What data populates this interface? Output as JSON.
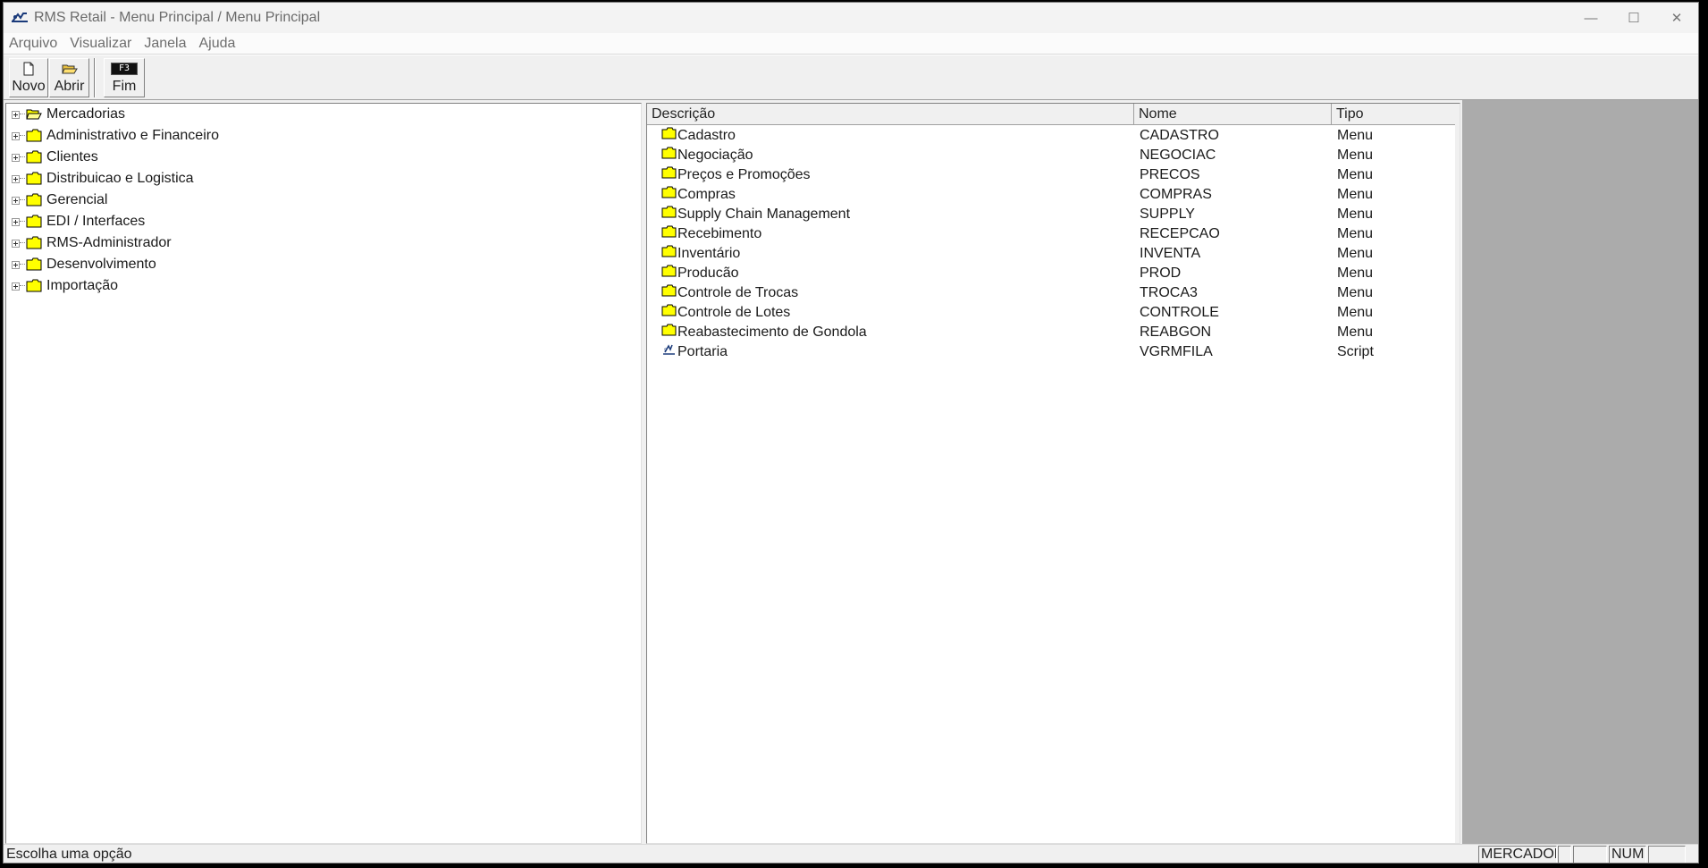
{
  "window": {
    "title": "RMS Retail - Menu Principal / Menu Principal",
    "minimize_glyph": "—",
    "maximize_glyph": "☐",
    "close_glyph": "✕"
  },
  "menubar": {
    "items": [
      "Arquivo",
      "Visualizar",
      "Janela",
      "Ajuda"
    ]
  },
  "toolbar": {
    "novo_label": "Novo",
    "novo_icon": "new-document-icon",
    "abrir_label": "Abrir",
    "abrir_icon": "open-folder-icon",
    "fim_label": "Fim",
    "fim_key": "F3"
  },
  "tree": {
    "items": [
      {
        "label": "Mercadorias",
        "icon": "open-folder-icon"
      },
      {
        "label": "Administrativo e Financeiro",
        "icon": "folder-icon"
      },
      {
        "label": "Clientes",
        "icon": "folder-icon"
      },
      {
        "label": "Distribuicao e Logistica",
        "icon": "folder-icon"
      },
      {
        "label": "Gerencial",
        "icon": "folder-icon"
      },
      {
        "label": "EDI / Interfaces",
        "icon": "folder-icon"
      },
      {
        "label": "RMS-Administrador",
        "icon": "folder-icon"
      },
      {
        "label": "Desenvolvimento",
        "icon": "folder-icon"
      },
      {
        "label": "Importação",
        "icon": "folder-icon"
      }
    ]
  },
  "list": {
    "columns": [
      "Descrição",
      "Nome",
      "Tipo"
    ],
    "rows": [
      {
        "descricao": "Cadastro",
        "nome": "CADASTRO",
        "tipo": "Menu",
        "icon": "folder-icon"
      },
      {
        "descricao": "Negociação",
        "nome": "NEGOCIAC",
        "tipo": "Menu",
        "icon": "folder-icon"
      },
      {
        "descricao": "Preços e Promoções",
        "nome": "PRECOS",
        "tipo": "Menu",
        "icon": "folder-icon"
      },
      {
        "descricao": "Compras",
        "nome": "COMPRAS",
        "tipo": "Menu",
        "icon": "folder-icon"
      },
      {
        "descricao": "Supply Chain Management",
        "nome": "SUPPLY",
        "tipo": "Menu",
        "icon": "folder-icon"
      },
      {
        "descricao": "Recebimento",
        "nome": "RECEPCAO",
        "tipo": "Menu",
        "icon": "folder-icon"
      },
      {
        "descricao": "Inventário",
        "nome": "INVENTA",
        "tipo": "Menu",
        "icon": "folder-icon"
      },
      {
        "descricao": "Producão",
        "nome": "PROD",
        "tipo": "Menu",
        "icon": "folder-icon"
      },
      {
        "descricao": "Controle de Trocas",
        "nome": "TROCA3",
        "tipo": "Menu",
        "icon": "folder-icon"
      },
      {
        "descricao": "Controle de Lotes",
        "nome": "CONTROLE",
        "tipo": "Menu",
        "icon": "folder-icon"
      },
      {
        "descricao": "Reabastecimento de Gondola",
        "nome": "REABGON",
        "tipo": "Menu",
        "icon": "folder-icon"
      },
      {
        "descricao": "Portaria",
        "nome": "VGRMFILA",
        "tipo": "Script",
        "icon": "script-icon"
      }
    ]
  },
  "statusbar": {
    "message": "Escolha uma opção",
    "panels": [
      "MERCADOR",
      "",
      "",
      "NUM",
      ""
    ]
  },
  "colors": {
    "folder_yellow": "#ffff00",
    "mdi_gray": "#ababab",
    "window_bg": "#f0f0f0"
  }
}
